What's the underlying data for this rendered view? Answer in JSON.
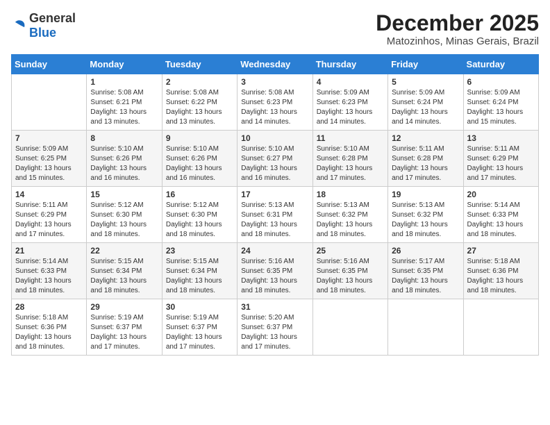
{
  "logo": {
    "text_general": "General",
    "text_blue": "Blue"
  },
  "title": {
    "month": "December 2025",
    "location": "Matozinhos, Minas Gerais, Brazil"
  },
  "weekdays": [
    "Sunday",
    "Monday",
    "Tuesday",
    "Wednesday",
    "Thursday",
    "Friday",
    "Saturday"
  ],
  "weeks": [
    [
      {
        "day": "",
        "info": ""
      },
      {
        "day": "1",
        "info": "Sunrise: 5:08 AM\nSunset: 6:21 PM\nDaylight: 13 hours\nand 13 minutes."
      },
      {
        "day": "2",
        "info": "Sunrise: 5:08 AM\nSunset: 6:22 PM\nDaylight: 13 hours\nand 13 minutes."
      },
      {
        "day": "3",
        "info": "Sunrise: 5:08 AM\nSunset: 6:23 PM\nDaylight: 13 hours\nand 14 minutes."
      },
      {
        "day": "4",
        "info": "Sunrise: 5:09 AM\nSunset: 6:23 PM\nDaylight: 13 hours\nand 14 minutes."
      },
      {
        "day": "5",
        "info": "Sunrise: 5:09 AM\nSunset: 6:24 PM\nDaylight: 13 hours\nand 14 minutes."
      },
      {
        "day": "6",
        "info": "Sunrise: 5:09 AM\nSunset: 6:24 PM\nDaylight: 13 hours\nand 15 minutes."
      }
    ],
    [
      {
        "day": "7",
        "info": "Sunrise: 5:09 AM\nSunset: 6:25 PM\nDaylight: 13 hours\nand 15 minutes."
      },
      {
        "day": "8",
        "info": "Sunrise: 5:10 AM\nSunset: 6:26 PM\nDaylight: 13 hours\nand 16 minutes."
      },
      {
        "day": "9",
        "info": "Sunrise: 5:10 AM\nSunset: 6:26 PM\nDaylight: 13 hours\nand 16 minutes."
      },
      {
        "day": "10",
        "info": "Sunrise: 5:10 AM\nSunset: 6:27 PM\nDaylight: 13 hours\nand 16 minutes."
      },
      {
        "day": "11",
        "info": "Sunrise: 5:10 AM\nSunset: 6:28 PM\nDaylight: 13 hours\nand 17 minutes."
      },
      {
        "day": "12",
        "info": "Sunrise: 5:11 AM\nSunset: 6:28 PM\nDaylight: 13 hours\nand 17 minutes."
      },
      {
        "day": "13",
        "info": "Sunrise: 5:11 AM\nSunset: 6:29 PM\nDaylight: 13 hours\nand 17 minutes."
      }
    ],
    [
      {
        "day": "14",
        "info": "Sunrise: 5:11 AM\nSunset: 6:29 PM\nDaylight: 13 hours\nand 17 minutes."
      },
      {
        "day": "15",
        "info": "Sunrise: 5:12 AM\nSunset: 6:30 PM\nDaylight: 13 hours\nand 18 minutes."
      },
      {
        "day": "16",
        "info": "Sunrise: 5:12 AM\nSunset: 6:30 PM\nDaylight: 13 hours\nand 18 minutes."
      },
      {
        "day": "17",
        "info": "Sunrise: 5:13 AM\nSunset: 6:31 PM\nDaylight: 13 hours\nand 18 minutes."
      },
      {
        "day": "18",
        "info": "Sunrise: 5:13 AM\nSunset: 6:32 PM\nDaylight: 13 hours\nand 18 minutes."
      },
      {
        "day": "19",
        "info": "Sunrise: 5:13 AM\nSunset: 6:32 PM\nDaylight: 13 hours\nand 18 minutes."
      },
      {
        "day": "20",
        "info": "Sunrise: 5:14 AM\nSunset: 6:33 PM\nDaylight: 13 hours\nand 18 minutes."
      }
    ],
    [
      {
        "day": "21",
        "info": "Sunrise: 5:14 AM\nSunset: 6:33 PM\nDaylight: 13 hours\nand 18 minutes."
      },
      {
        "day": "22",
        "info": "Sunrise: 5:15 AM\nSunset: 6:34 PM\nDaylight: 13 hours\nand 18 minutes."
      },
      {
        "day": "23",
        "info": "Sunrise: 5:15 AM\nSunset: 6:34 PM\nDaylight: 13 hours\nand 18 minutes."
      },
      {
        "day": "24",
        "info": "Sunrise: 5:16 AM\nSunset: 6:35 PM\nDaylight: 13 hours\nand 18 minutes."
      },
      {
        "day": "25",
        "info": "Sunrise: 5:16 AM\nSunset: 6:35 PM\nDaylight: 13 hours\nand 18 minutes."
      },
      {
        "day": "26",
        "info": "Sunrise: 5:17 AM\nSunset: 6:35 PM\nDaylight: 13 hours\nand 18 minutes."
      },
      {
        "day": "27",
        "info": "Sunrise: 5:18 AM\nSunset: 6:36 PM\nDaylight: 13 hours\nand 18 minutes."
      }
    ],
    [
      {
        "day": "28",
        "info": "Sunrise: 5:18 AM\nSunset: 6:36 PM\nDaylight: 13 hours\nand 18 minutes."
      },
      {
        "day": "29",
        "info": "Sunrise: 5:19 AM\nSunset: 6:37 PM\nDaylight: 13 hours\nand 17 minutes."
      },
      {
        "day": "30",
        "info": "Sunrise: 5:19 AM\nSunset: 6:37 PM\nDaylight: 13 hours\nand 17 minutes."
      },
      {
        "day": "31",
        "info": "Sunrise: 5:20 AM\nSunset: 6:37 PM\nDaylight: 13 hours\nand 17 minutes."
      },
      {
        "day": "",
        "info": ""
      },
      {
        "day": "",
        "info": ""
      },
      {
        "day": "",
        "info": ""
      }
    ]
  ]
}
